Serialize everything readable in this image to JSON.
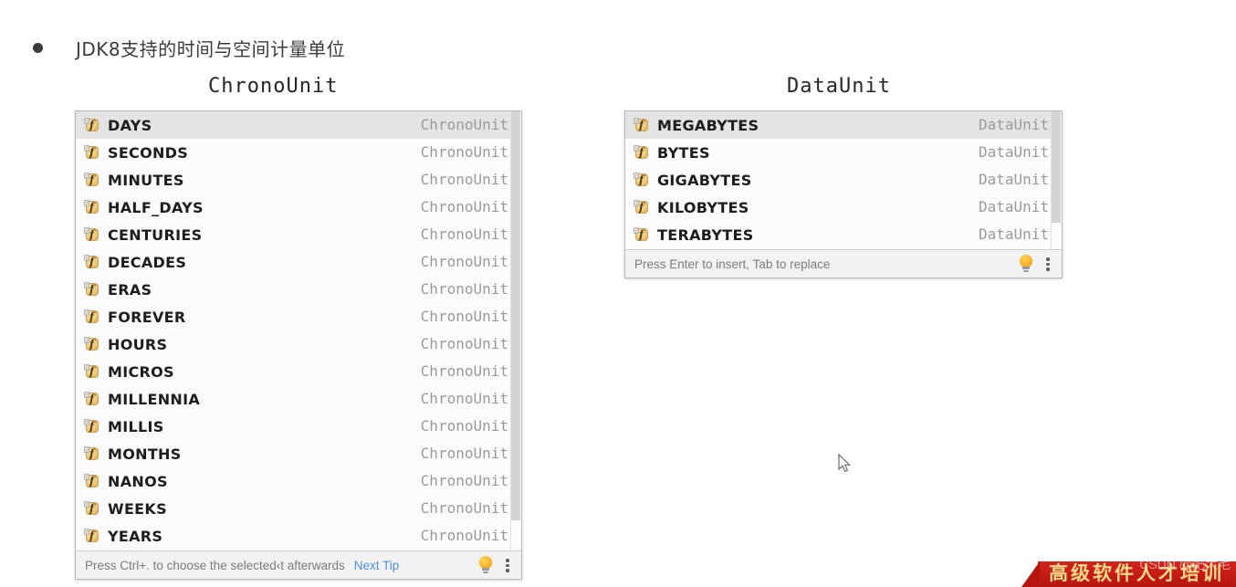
{
  "slide": {
    "bullet_text": "JDK8支持的时间与空间计量单位"
  },
  "left_panel": {
    "title": "ChronoUnit",
    "type_label": "ChronoUnit",
    "selected_index": 0,
    "items": [
      {
        "name": "DAYS",
        "type": "ChronoUnit",
        "icon": "field-icon"
      },
      {
        "name": "SECONDS",
        "type": "ChronoUnit",
        "icon": "field-icon"
      },
      {
        "name": "MINUTES",
        "type": "ChronoUnit",
        "icon": "field-icon"
      },
      {
        "name": "HALF_DAYS",
        "type": "ChronoUnit",
        "icon": "field-icon"
      },
      {
        "name": "CENTURIES",
        "type": "ChronoUnit",
        "icon": "field-icon"
      },
      {
        "name": "DECADES",
        "type": "ChronoUnit",
        "icon": "field-icon"
      },
      {
        "name": "ERAS",
        "type": "ChronoUnit",
        "icon": "field-icon"
      },
      {
        "name": "FOREVER",
        "type": "ChronoUnit",
        "icon": "field-icon"
      },
      {
        "name": "HOURS",
        "type": "ChronoUnit",
        "icon": "field-icon"
      },
      {
        "name": "MICROS",
        "type": "ChronoUnit",
        "icon": "field-icon"
      },
      {
        "name": "MILLENNIA",
        "type": "ChronoUnit",
        "icon": "field-icon"
      },
      {
        "name": "MILLIS",
        "type": "ChronoUnit",
        "icon": "field-icon"
      },
      {
        "name": "MONTHS",
        "type": "ChronoUnit",
        "icon": "field-icon"
      },
      {
        "name": "NANOS",
        "type": "ChronoUnit",
        "icon": "field-icon"
      },
      {
        "name": "WEEKS",
        "type": "ChronoUnit",
        "icon": "field-icon"
      },
      {
        "name": "YEARS",
        "type": "ChronoUnit",
        "icon": "field-icon"
      }
    ],
    "footer": {
      "hint": "Press Ctrl+. to choose the selected‹t afterwards",
      "link": "Next Tip",
      "bulb_icon": "lightbulb-icon",
      "menu_icon": "kebab-menu-icon"
    }
  },
  "right_panel": {
    "title": "DataUnit",
    "type_label": "DataUnit",
    "selected_index": 0,
    "items": [
      {
        "name": "MEGABYTES",
        "type": "DataUnit",
        "icon": "field-icon"
      },
      {
        "name": "BYTES",
        "type": "DataUnit",
        "icon": "field-icon"
      },
      {
        "name": "GIGABYTES",
        "type": "DataUnit",
        "icon": "field-icon"
      },
      {
        "name": "KILOBYTES",
        "type": "DataUnit",
        "icon": "field-icon"
      },
      {
        "name": "TERABYTES",
        "type": "DataUnit",
        "icon": "field-icon"
      }
    ],
    "footer": {
      "hint": "Press Enter to insert, Tab to replace",
      "bulb_icon": "lightbulb-icon",
      "menu_icon": "kebab-menu-icon"
    }
  },
  "watermark": {
    "banner_text": "高级软件人才培训",
    "csdn_text": "CSDN @肥大毛"
  },
  "colors": {
    "selected_row": "#e4e4e4",
    "row_background": "#fbfbfb",
    "type_text": "#9a9a9a",
    "name_text": "#1d1d1d",
    "link": "#4a90d9",
    "banner_red": "#c01a12",
    "banner_gold": "#ffd98a",
    "icon_orange": "#f0c97a"
  }
}
